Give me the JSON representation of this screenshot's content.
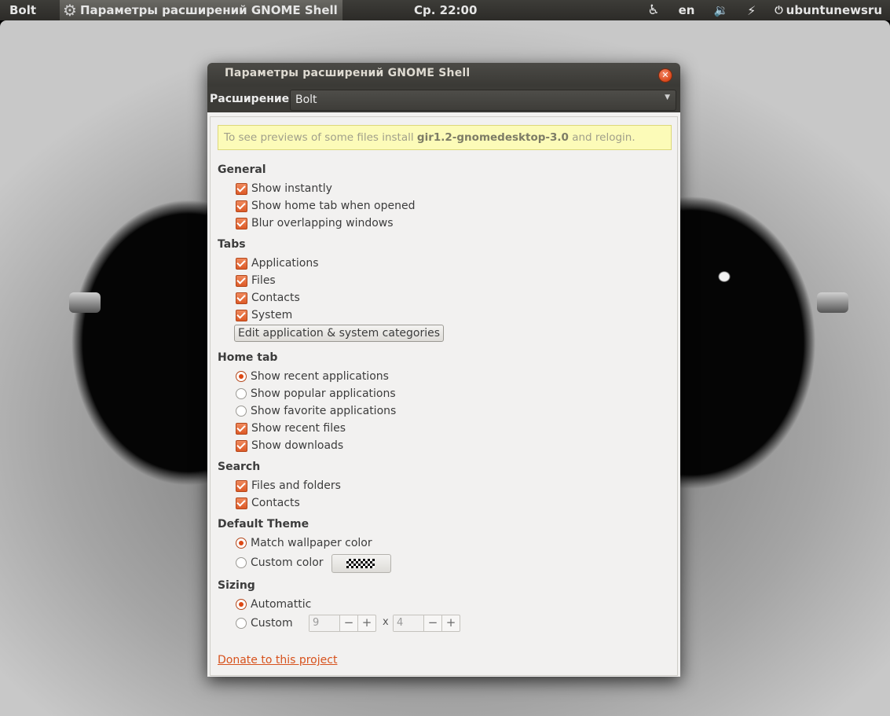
{
  "top_panel": {
    "app_name": "Bolt",
    "active_window_title": "Параметры расширений GNOME Shell",
    "clock": "Ср. 22:00",
    "language": "en",
    "user": "ubuntunewsru"
  },
  "dialog": {
    "title": "Параметры расширений GNOME Shell",
    "extension_label": "Расширение",
    "extension_selected": "Bolt",
    "infobar": {
      "prefix": "To see previews of some files install ",
      "package": "gir1.2-gnomedesktop-3.0",
      "suffix": " and relogin."
    },
    "sections": {
      "general": {
        "heading": "General",
        "show_instantly": {
          "label": "Show instantly",
          "checked": true
        },
        "show_home_tab": {
          "label": "Show home tab when opened",
          "checked": true
        },
        "blur_windows": {
          "label": "Blur overlapping windows",
          "checked": true
        }
      },
      "tabs": {
        "heading": "Tabs",
        "applications": {
          "label": "Applications",
          "checked": true
        },
        "files": {
          "label": "Files",
          "checked": true
        },
        "contacts": {
          "label": "Contacts",
          "checked": true
        },
        "system": {
          "label": "System",
          "checked": true
        },
        "edit_button": "Edit application & system categories"
      },
      "home_tab": {
        "heading": "Home tab",
        "recent_apps": {
          "label": "Show recent applications",
          "selected": true
        },
        "popular_apps": {
          "label": "Show popular applications",
          "selected": false
        },
        "favorite_apps": {
          "label": "Show favorite applications",
          "selected": false
        },
        "recent_files": {
          "label": "Show recent files",
          "checked": true
        },
        "downloads": {
          "label": "Show downloads",
          "checked": true
        }
      },
      "search": {
        "heading": "Search",
        "files_folders": {
          "label": "Files and folders",
          "checked": true
        },
        "contacts": {
          "label": "Contacts",
          "checked": true
        }
      },
      "default_theme": {
        "heading": "Default Theme",
        "match_wallpaper": {
          "label": "Match wallpaper color",
          "selected": true
        },
        "custom_color": {
          "label": "Custom color",
          "selected": false
        }
      },
      "sizing": {
        "heading": "Sizing",
        "automatic": {
          "label": "Automattic",
          "selected": true
        },
        "custom": {
          "label": "Custom",
          "selected": false
        },
        "columns": "9",
        "rows": "4",
        "separator": "x",
        "minus": "−",
        "plus": "+"
      }
    },
    "donate_link": "Donate to this project"
  }
}
